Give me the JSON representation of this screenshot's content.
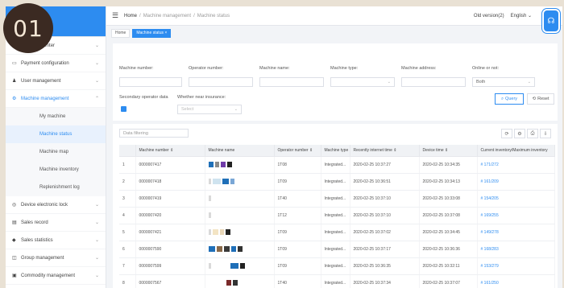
{
  "step_badge": "01",
  "header": {
    "breadcrumb": [
      "Home",
      "Machine management",
      "Machine status"
    ],
    "old_version": "Old version(2)",
    "language": "English",
    "menu_icon": "hamburger-icon",
    "assistant_icon": "headset-icon"
  },
  "tags": [
    {
      "label": "Home",
      "active": false
    },
    {
      "label": "Machine status",
      "active": true
    }
  ],
  "sidebar": {
    "items_top": [
      {
        "label": "Personal center",
        "icon": "user-icon"
      },
      {
        "label": "Payment configuration",
        "icon": "card-icon"
      },
      {
        "label": "User management",
        "icon": "person-icon"
      },
      {
        "label": "Machine management",
        "icon": "machine-icon",
        "expanded": true
      }
    ],
    "subitems": [
      {
        "label": "My machine",
        "active": false
      },
      {
        "label": "Machine status",
        "active": true
      },
      {
        "label": "Machine map",
        "active": false
      },
      {
        "label": "Machine inventory",
        "active": false
      },
      {
        "label": "Replenishment log",
        "active": false
      }
    ],
    "items_bottom": [
      {
        "label": "Device electronic lock",
        "icon": "lock-icon"
      },
      {
        "label": "Sales record",
        "icon": "doc-icon"
      },
      {
        "label": "Sales statistics",
        "icon": "chart-icon"
      },
      {
        "label": "Group management",
        "icon": "group-icon"
      },
      {
        "label": "Commodity management",
        "icon": "box-icon"
      }
    ]
  },
  "filters": {
    "labels": [
      "Machine number:",
      "Operator number:",
      "Machine name:",
      "Machine type:",
      "Machine address:",
      "Online or not:"
    ],
    "online_value": "Both",
    "secondary_label": "Secondary operator data",
    "insurance_label": "Whether near insurance:",
    "insurance_placeholder": "Select",
    "query_label": "Query",
    "reset_label": "Reset"
  },
  "table": {
    "search_placeholder": "Data filtering",
    "toolbar_icons": [
      "refresh-icon",
      "settings-icon",
      "print-icon",
      "export-icon"
    ],
    "columns": [
      "",
      "Machine number",
      "Machine name",
      "Operator number",
      "Machine type",
      "Recently internet time",
      "Device time",
      "Current inventory/Maximum inventory"
    ],
    "rows": [
      {
        "idx": "1",
        "number": "0000007417",
        "operator": "1T08",
        "type": "Integrated...",
        "internet": "2020-02-25 10:37:27",
        "device": "2020-02-25 10:34:35",
        "inventory": "171/272",
        "blur": [
          [
            "#1f6fb8",
            6
          ],
          [
            "#8a8a8a",
            5
          ],
          [
            "#6f3ba8",
            6
          ],
          [
            "#222",
            6
          ]
        ]
      },
      {
        "idx": "2",
        "number": "0000007418",
        "operator": "1T09",
        "type": "Integrated...",
        "internet": "2020-02-25 10:36:51",
        "device": "2020-02-25 10:34:13",
        "inventory": "161/209",
        "blur": [
          [
            "#d9d9d9",
            3
          ],
          [
            "#cfe3ef",
            10
          ],
          [
            "#1f6fb8",
            8
          ],
          [
            "#7aa7d6",
            5
          ]
        ]
      },
      {
        "idx": "3",
        "number": "0000007419",
        "operator": "1T40",
        "type": "Integrated...",
        "internet": "2020-02-25 10:37:10",
        "device": "2020-02-25 10:33:08",
        "inventory": "154/205",
        "blur": [
          [
            "#d9d9d9",
            3
          ]
        ]
      },
      {
        "idx": "4",
        "number": "0000007420",
        "operator": "1T12",
        "type": "Integrated...",
        "internet": "2020-02-25 10:37:10",
        "device": "2020-02-25 10:37:08",
        "inventory": "169/255",
        "blur": [
          [
            "#d9d9d9",
            3
          ]
        ]
      },
      {
        "idx": "5",
        "number": "0000007421",
        "operator": "1T09",
        "type": "Integrated...",
        "internet": "2020-02-25 10:37:02",
        "device": "2020-02-25 10:34:45",
        "inventory": "149/278",
        "blur": [
          [
            "#d9d9d9",
            3
          ],
          [
            "#f3e4c4",
            7
          ],
          [
            "#e9d7b8",
            5
          ],
          [
            "#222",
            6
          ]
        ]
      },
      {
        "idx": "6",
        "number": "0000007590",
        "operator": "1T09",
        "type": "Integrated...",
        "internet": "2020-02-25 10:37:17",
        "device": "2020-02-25 10:36:36",
        "inventory": "168/283",
        "blur": [
          [
            "#1f6fb8",
            8
          ],
          [
            "#8a6a4a",
            7
          ],
          [
            "#3a3a3a",
            7
          ],
          [
            "#1f6fb8",
            6
          ],
          [
            "#333",
            6
          ]
        ]
      },
      {
        "idx": "7",
        "number": "0000007599",
        "operator": "1T09",
        "type": "Integrated...",
        "internet": "2020-02-25 10:36:35",
        "device": "2020-02-25 10:32:11",
        "inventory": "153/279",
        "blur": [
          [
            "#d9d9d9",
            3
          ],
          [
            "#ffffff",
            20
          ],
          [
            "#1f6fb8",
            10
          ],
          [
            "#222",
            6
          ]
        ]
      },
      {
        "idx": "8",
        "number": "0000007567",
        "operator": "1T40",
        "type": "Integrated...",
        "internet": "2020-02-25 10:37:34",
        "device": "2020-02-25 10:37:07",
        "inventory": "161/250",
        "blur": [
          [
            "#ffffff",
            20
          ],
          [
            "#7a2a2a",
            6
          ],
          [
            "#333",
            6
          ]
        ]
      }
    ]
  }
}
